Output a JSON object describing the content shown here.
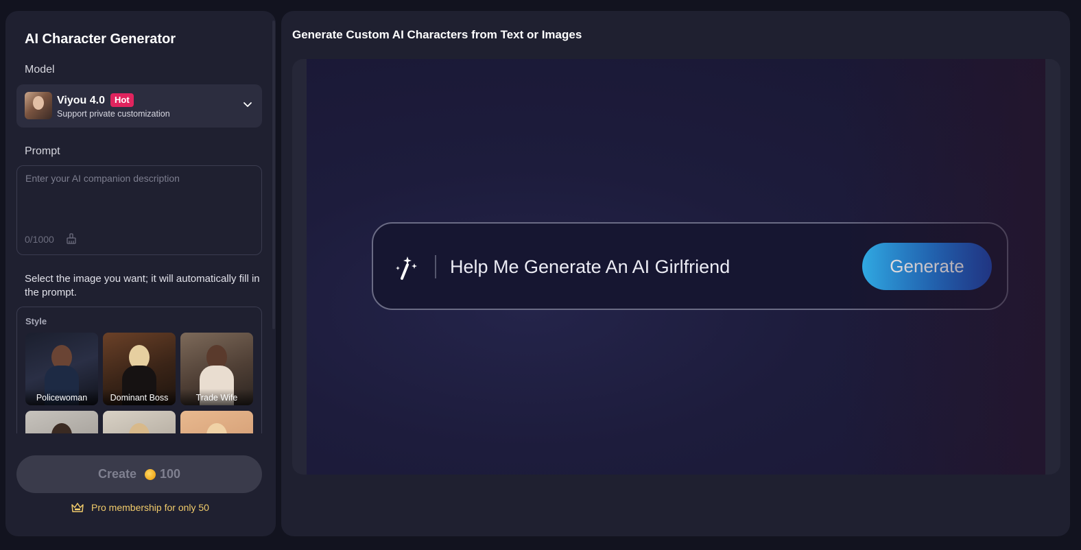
{
  "sidebar": {
    "title": "AI Character Generator",
    "model_label": "Model",
    "model": {
      "name": "Viyou 4.0",
      "badge": "Hot",
      "subtitle": "Support private customization"
    },
    "prompt_label": "Prompt",
    "prompt": {
      "value": "",
      "placeholder": "Enter your AI companion description",
      "char_count": "0/1000"
    },
    "hint": "Select the image you want; it will automatically fill in the prompt.",
    "style_title": "Style",
    "styles": [
      {
        "label": "Policewoman"
      },
      {
        "label": "Dominant Boss"
      },
      {
        "label": "Trade Wife"
      },
      {
        "label": ""
      },
      {
        "label": ""
      },
      {
        "label": ""
      }
    ],
    "create": {
      "label": "Create",
      "cost": "100",
      "icon": "coin-icon"
    },
    "pro_link": "Pro membership for only 50"
  },
  "main": {
    "heading": "Generate Custom AI Characters from Text or Images",
    "demo": {
      "text": "Help Me Generate An AI Girlfriend",
      "button": "Generate"
    }
  },
  "colors": {
    "background": "#12131f",
    "panel": "#1f2030",
    "hot_badge": "#e0245e",
    "generate_gradient_start": "#31b4ef",
    "generate_gradient_end": "#1b4fc9",
    "pro_link": "#f2cc6b"
  }
}
